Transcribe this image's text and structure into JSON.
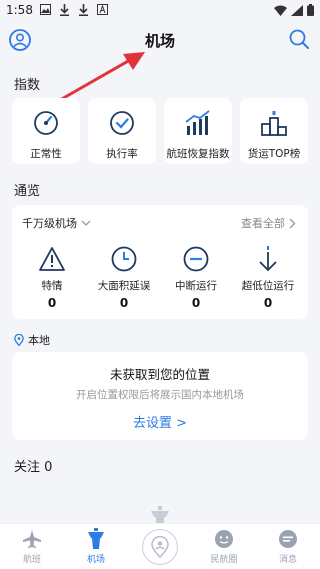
{
  "status_bar": {
    "time": "1:58"
  },
  "header": {
    "title": "机场"
  },
  "sections": {
    "index_title": "指数",
    "overview_title": "通览",
    "follow_title": "关注 0"
  },
  "index_cards": [
    {
      "label": "正常性",
      "icon": "gauge-icon"
    },
    {
      "label": "执行率",
      "icon": "check-circle-icon"
    },
    {
      "label": "航班恢复指数",
      "icon": "bar-trend-icon"
    },
    {
      "label": "货运TOP榜",
      "icon": "podium-icon"
    }
  ],
  "overview": {
    "filter_label": "千万级机场",
    "view_all": "查看全部",
    "items": [
      {
        "label": "特情",
        "value": "0",
        "icon": "warning-icon"
      },
      {
        "label": "大面积延误",
        "value": "0",
        "icon": "clock-icon"
      },
      {
        "label": "中断运行",
        "value": "0",
        "icon": "minus-circle-icon"
      },
      {
        "label": "超低位运行",
        "value": "0",
        "icon": "arrow-down-icon"
      }
    ]
  },
  "local": {
    "label": "本地",
    "title": "未获取到您的位置",
    "subtitle": "开启位置权限后将展示国内本地机场",
    "action": "去设置 >"
  },
  "bottom_nav": [
    {
      "label": "航班",
      "icon": "plane-icon",
      "active": false
    },
    {
      "label": "机场",
      "icon": "tower-icon",
      "active": true
    },
    {
      "label": "",
      "icon": "location-person-icon",
      "active": false
    },
    {
      "label": "民航圈",
      "icon": "circle-face-icon",
      "active": false
    },
    {
      "label": "消息",
      "icon": "chat-icon",
      "active": false
    }
  ],
  "colors": {
    "accent": "#2d7be5",
    "icon_dark": "#1f3a5f",
    "annotation_arrow": "#e0333a"
  }
}
